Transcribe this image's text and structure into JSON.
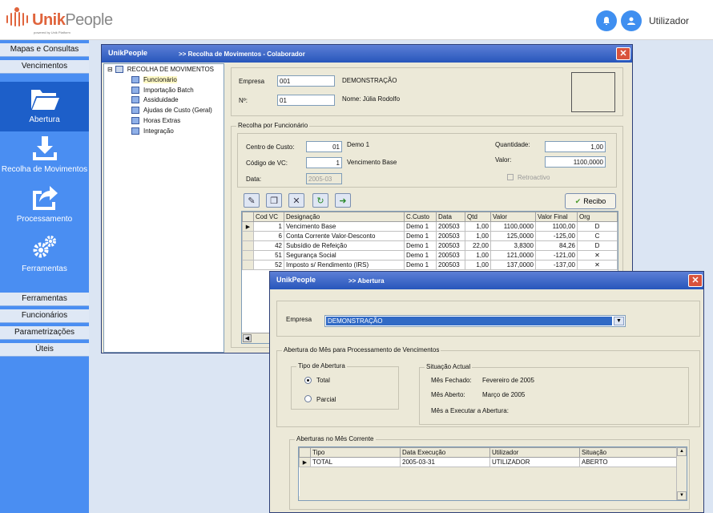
{
  "app": {
    "brand_unik": "Unik",
    "brand_people": "People",
    "brand_sub": "powered by Unik Platform",
    "user_label": "Utilizador"
  },
  "sidebar": {
    "top_items": [
      "Mapas e Consultas",
      "Vencimentos"
    ],
    "big_items": [
      {
        "label": "Abertura",
        "icon": "folder-open-icon"
      },
      {
        "label": "Recolha de Movimentos",
        "icon": "download-icon"
      },
      {
        "label": "Processamento",
        "icon": "share-icon"
      },
      {
        "label": "Ferramentas",
        "icon": "gears-icon"
      }
    ],
    "bottom_items": [
      "Ferramentas",
      "Funcionários",
      "Parametrizações",
      "Úteis"
    ]
  },
  "win1": {
    "title": ">> Recolha  de Movimentos  - Colaborador",
    "tree_root": "RECOLHA DE MOVIMENTOS",
    "tree_items": [
      "Funcionário",
      "Importação Batch",
      "Assiduidade",
      "Ajudas de Custo (Geral)",
      "Horas Extras",
      "Integração"
    ],
    "empresa_label": "Empresa",
    "empresa_value": "001",
    "empresa_name": "DEMONSTRAÇÃO",
    "num_label": "Nº:",
    "num_value": "01",
    "nome_text": "Nome: Júlia Rodolfo",
    "group_label": "Recolha por Funcionário",
    "centro_label": "Centro de Custo:",
    "centro_value": "01",
    "centro_name": "Demo 1",
    "codigo_label": "Código de VC:",
    "codigo_value": "1",
    "codigo_name": "Vencimento Base",
    "data_label": "Data:",
    "data_value": "2005-03",
    "quantidade_label": "Quantidade:",
    "quantidade_value": "1,00",
    "valor_label": "Valor:",
    "valor_value": "1100,0000",
    "retroactivo_label": "Retroactivo",
    "recibo_label": "Recibo",
    "grid_headers": [
      "Cod VC",
      "Designação",
      "C.Custo",
      "Data",
      "Qtd",
      "Valor",
      "Valor Final",
      "Org"
    ],
    "grid_rows": [
      [
        "1",
        "Vencimento Base",
        "Demo 1",
        "200503",
        "1,00",
        "1100,0000",
        "1100,00",
        "D"
      ],
      [
        "6",
        "Conta Corrente Valor-Desconto",
        "Demo 1",
        "200503",
        "1,00",
        "125,0000",
        "-125,00",
        "C"
      ],
      [
        "42",
        "Subsídio de Refeição",
        "Demo 1",
        "200503",
        "22,00",
        "3,8300",
        "84,26",
        "D"
      ],
      [
        "51",
        "Segurança Social",
        "Demo 1",
        "200503",
        "1,00",
        "121,0000",
        "-121,00",
        "✕"
      ],
      [
        "52",
        "Imposto s/ Rendimento (IRS)",
        "Demo 1",
        "200503",
        "1,00",
        "137,0000",
        "-137,00",
        "✕"
      ]
    ]
  },
  "win2": {
    "title": ">> Abertura",
    "empresa_label": "Empresa",
    "empresa_value": "DEMONSTRAÇÃO",
    "group1_label": "Abertura do Mês para Processamento de Vencimentos",
    "tipo_label": "Tipo de Abertura",
    "radio_total": "Total",
    "radio_parcial": "Parcial",
    "situacao_label": "Situação Actual",
    "mes_fechado_label": "Mês Fechado:",
    "mes_fechado_value": "Fevereiro de 2005",
    "mes_aberto_label": "Mês Aberto:",
    "mes_aberto_value": "Março de 2005",
    "mes_executar_label": "Mês a Executar a Abertura:",
    "group2_label": "Aberturas no Mês Corrente",
    "grid_headers": [
      "Tipo",
      "Data Execução",
      "Utilizador",
      "Situação"
    ],
    "grid_rows": [
      [
        "TOTAL",
        "2005-03-31",
        "UTILIZADOR",
        "ABERTO"
      ]
    ]
  },
  "colors": {
    "sidebar": "#4a8ef2",
    "sidebar_active": "#1d5fc9",
    "title_bar": "#2756bb",
    "brand_orange": "#e0643c"
  }
}
